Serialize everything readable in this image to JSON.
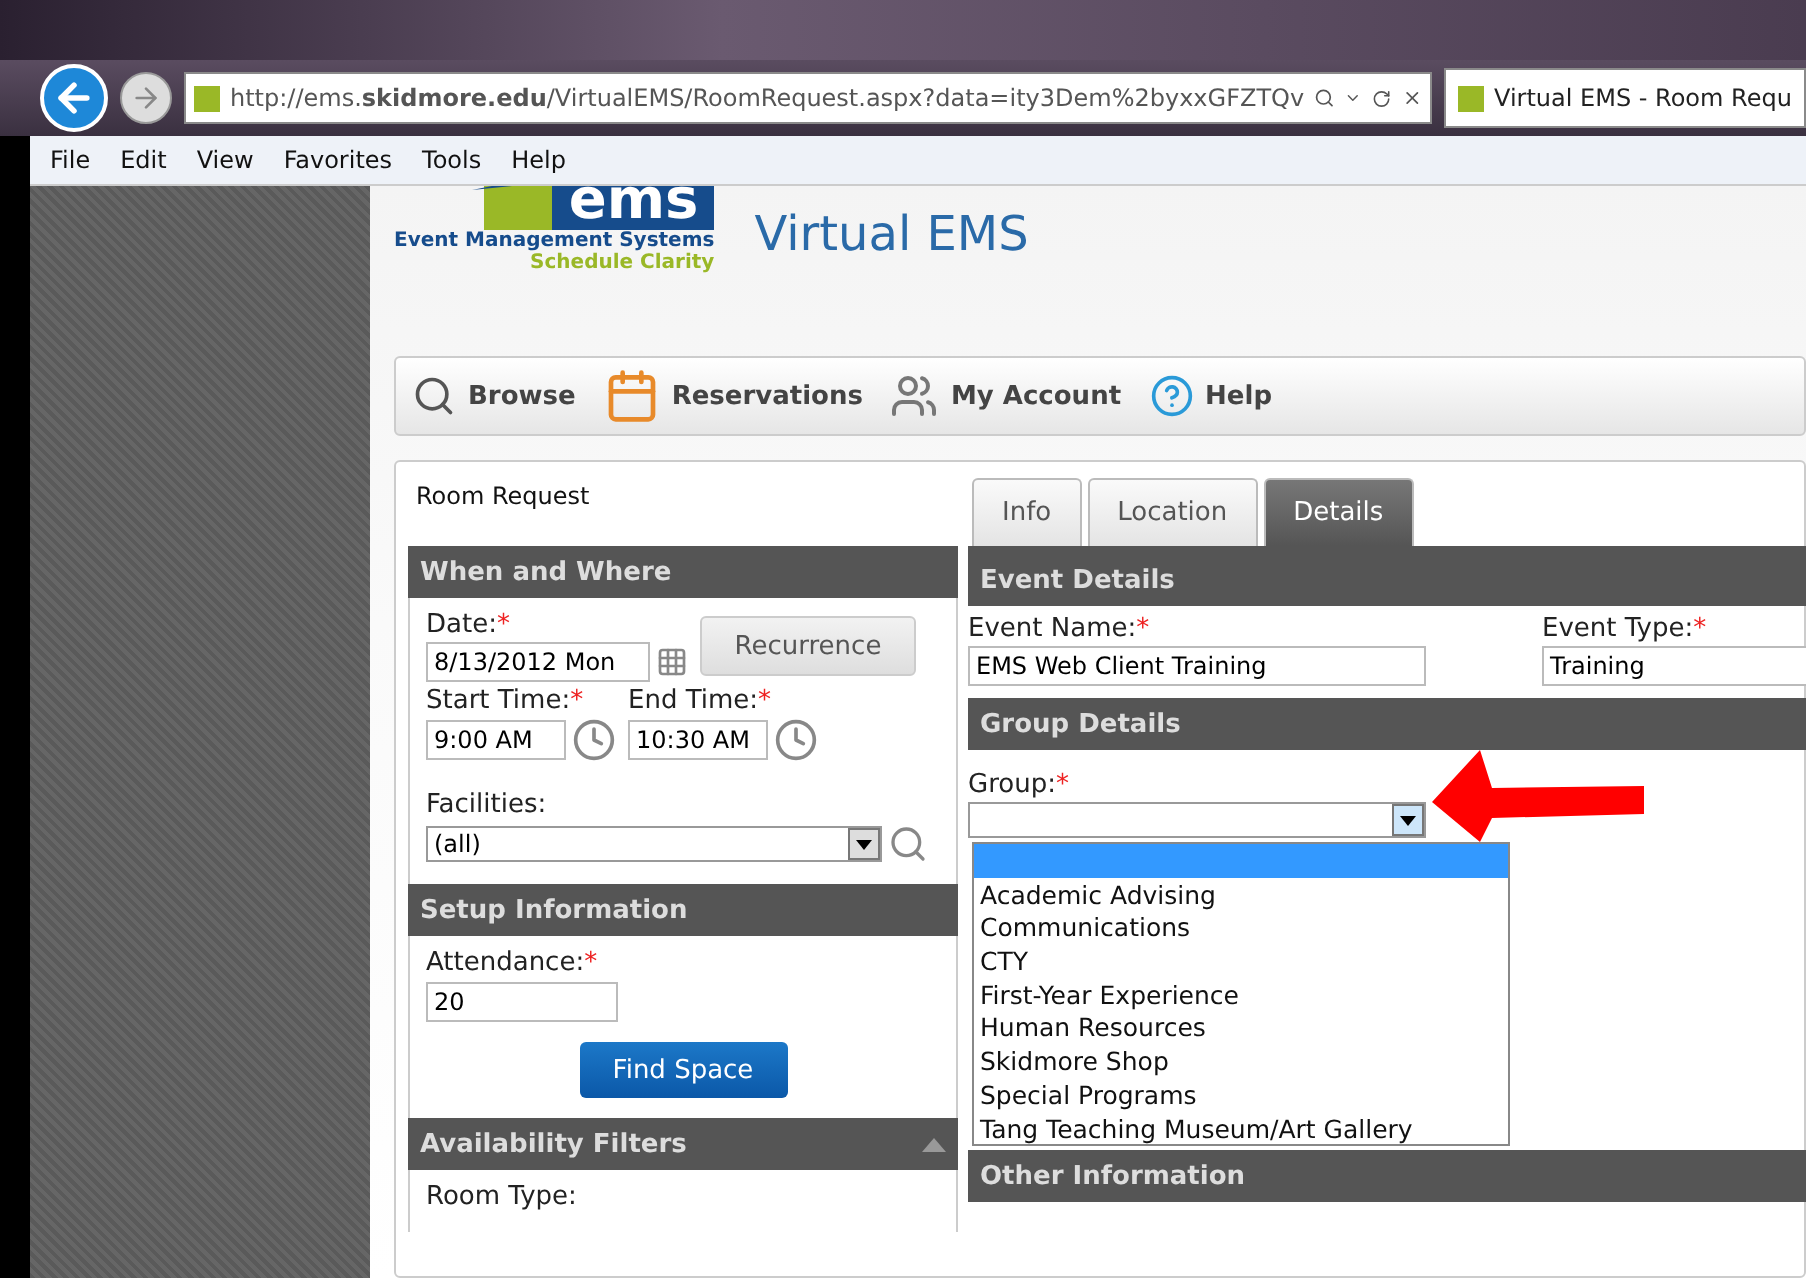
{
  "browser": {
    "url": "http://ems.**skidmore.edu**/VirtualEMS/RoomRequest.aspx?data=ity3Dem%2byxxGFZTQv",
    "tab_title": "Virtual EMS - Room Requ",
    "menu": [
      "File",
      "Edit",
      "View",
      "Favorites",
      "Tools",
      "Help"
    ]
  },
  "header": {
    "logo_word": "ems",
    "logo_caption": "Event Management Systems",
    "logo_tagline": "Schedule Clarity",
    "title": "Virtual EMS"
  },
  "nav": [
    {
      "kind": "browse",
      "label": "Browse"
    },
    {
      "kind": "reservations",
      "label": "Reservations"
    },
    {
      "kind": "account",
      "label": "My Account"
    },
    {
      "kind": "help",
      "label": "Help"
    }
  ],
  "page_title": "Room Request",
  "tabs": [
    {
      "label": "Info",
      "selected": false
    },
    {
      "label": "Location",
      "selected": false
    },
    {
      "label": "Details",
      "selected": true
    }
  ],
  "when_where": {
    "title": "When and Where",
    "date": {
      "label": "Date:",
      "mark": "*",
      "value": "8/13/2012 Mon"
    },
    "recurrence": "Recurrence",
    "start": {
      "label": "Start Time:",
      "mark": "*",
      "value": "9:00 AM"
    },
    "end": {
      "label": "End Time:",
      "mark": "*",
      "value": "10:30 AM"
    },
    "facilities": {
      "label": "Facilities:",
      "value": "(all)"
    }
  },
  "setup": {
    "title": "Setup Information",
    "attendance": {
      "label": "Attendance:",
      "mark": "*",
      "value": "20"
    },
    "find": "Find Space"
  },
  "filters": {
    "title": "Availability Filters",
    "expanded": true,
    "room_type": "Room Type:"
  },
  "event_details": {
    "title": "Event Details",
    "name": {
      "label": "Event Name:",
      "mark": "*",
      "value": "EMS Web Client Training"
    },
    "type": {
      "label": "Event Type:",
      "mark": "*",
      "value": "Training"
    }
  },
  "group_details": {
    "title": "Group Details",
    "group": {
      "label": "Group:",
      "mark": "*",
      "expanded": true,
      "blank_option": {
        "selected": true
      },
      "options": [
        {
          "label": "Academic Advising",
          "selected": false
        },
        {
          "label": "Communications",
          "selected": false
        },
        {
          "label": "CTY",
          "selected": false
        },
        {
          "label": "First-Year Experience",
          "selected": false
        },
        {
          "label": "Human Resources",
          "selected": false
        },
        {
          "label": "Skidmore Shop",
          "selected": false
        },
        {
          "label": "Special Programs",
          "selected": false
        },
        {
          "label": "Tang Teaching Museum/Art Gallery",
          "selected": false
        }
      ]
    }
  },
  "other": {
    "title": "Other Information"
  }
}
